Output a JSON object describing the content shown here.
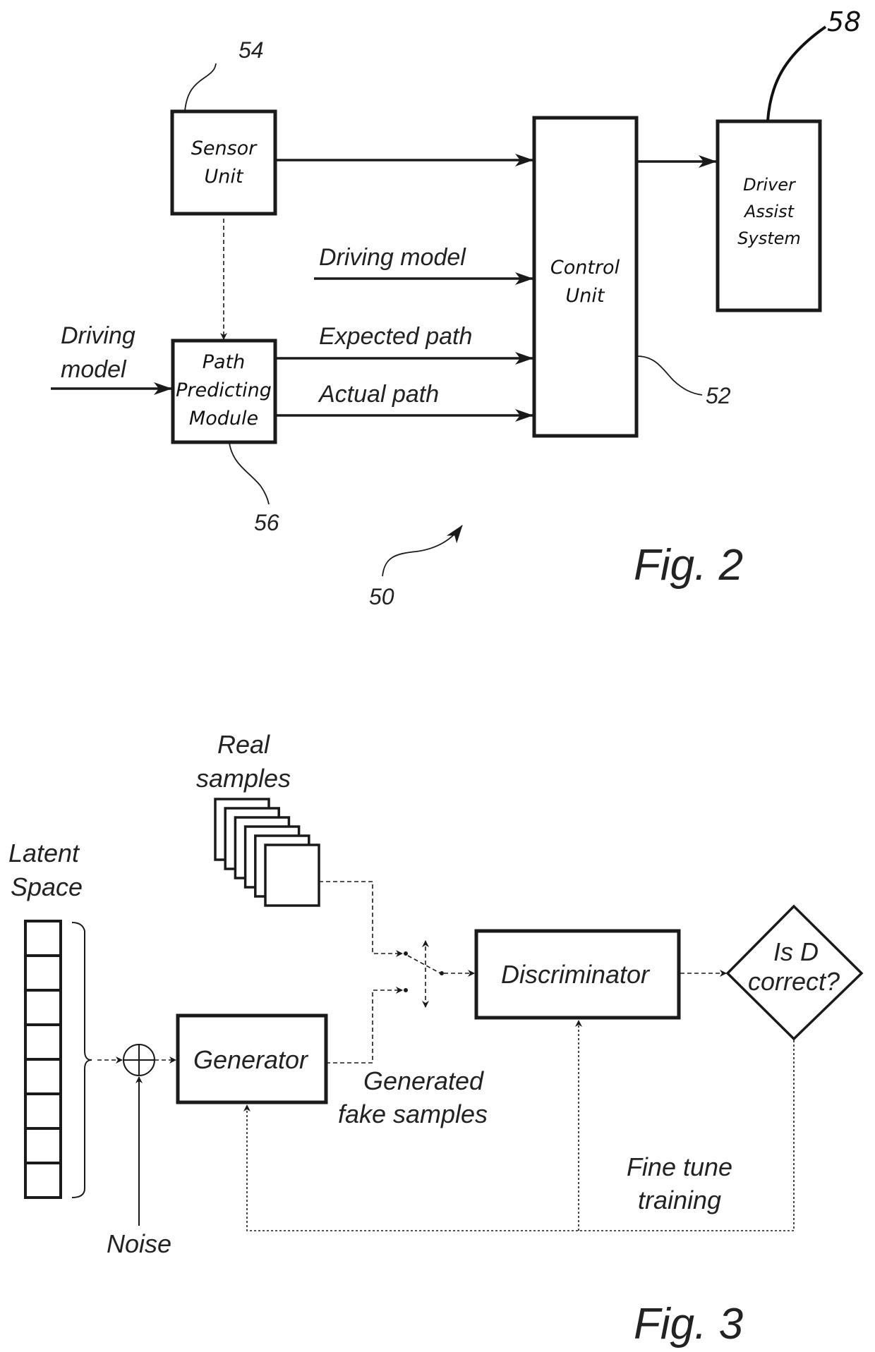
{
  "figure2": {
    "caption": "Fig. 2",
    "blocks": {
      "sensor_unit": {
        "line1": "Sensor",
        "line2": "Unit",
        "ref": "54"
      },
      "path_predicting_module": {
        "line1": "Path",
        "line2": "Predicting",
        "line3": "Module",
        "ref": "56"
      },
      "control_unit": {
        "line1": "Control",
        "line2": "Unit",
        "ref": "52"
      },
      "driver_assist_system": {
        "line1": "Driver",
        "line2": "Assist",
        "line3": "System",
        "ref": "58"
      }
    },
    "signals": {
      "driving_model_input_left": {
        "line1": "Driving",
        "line2": "model"
      },
      "driving_model_to_control": "Driving model",
      "expected_path": "Expected path",
      "actual_path": "Actual path"
    },
    "system_ref": "50"
  },
  "figure3": {
    "caption": "Fig. 3",
    "latent_space": {
      "line1": "Latent",
      "line2": "Space",
      "cells": 8
    },
    "real_samples": {
      "line1": "Real",
      "line2": "samples",
      "cards": 6
    },
    "noise": "Noise",
    "generator": "Generator",
    "generated_fake_samples": {
      "line1": "Generated",
      "line2": "fake samples"
    },
    "discriminator": "Discriminator",
    "decision": {
      "line1": "Is D",
      "line2": "correct?"
    },
    "feedback": {
      "line1": "Fine tune",
      "line2": "training"
    }
  }
}
